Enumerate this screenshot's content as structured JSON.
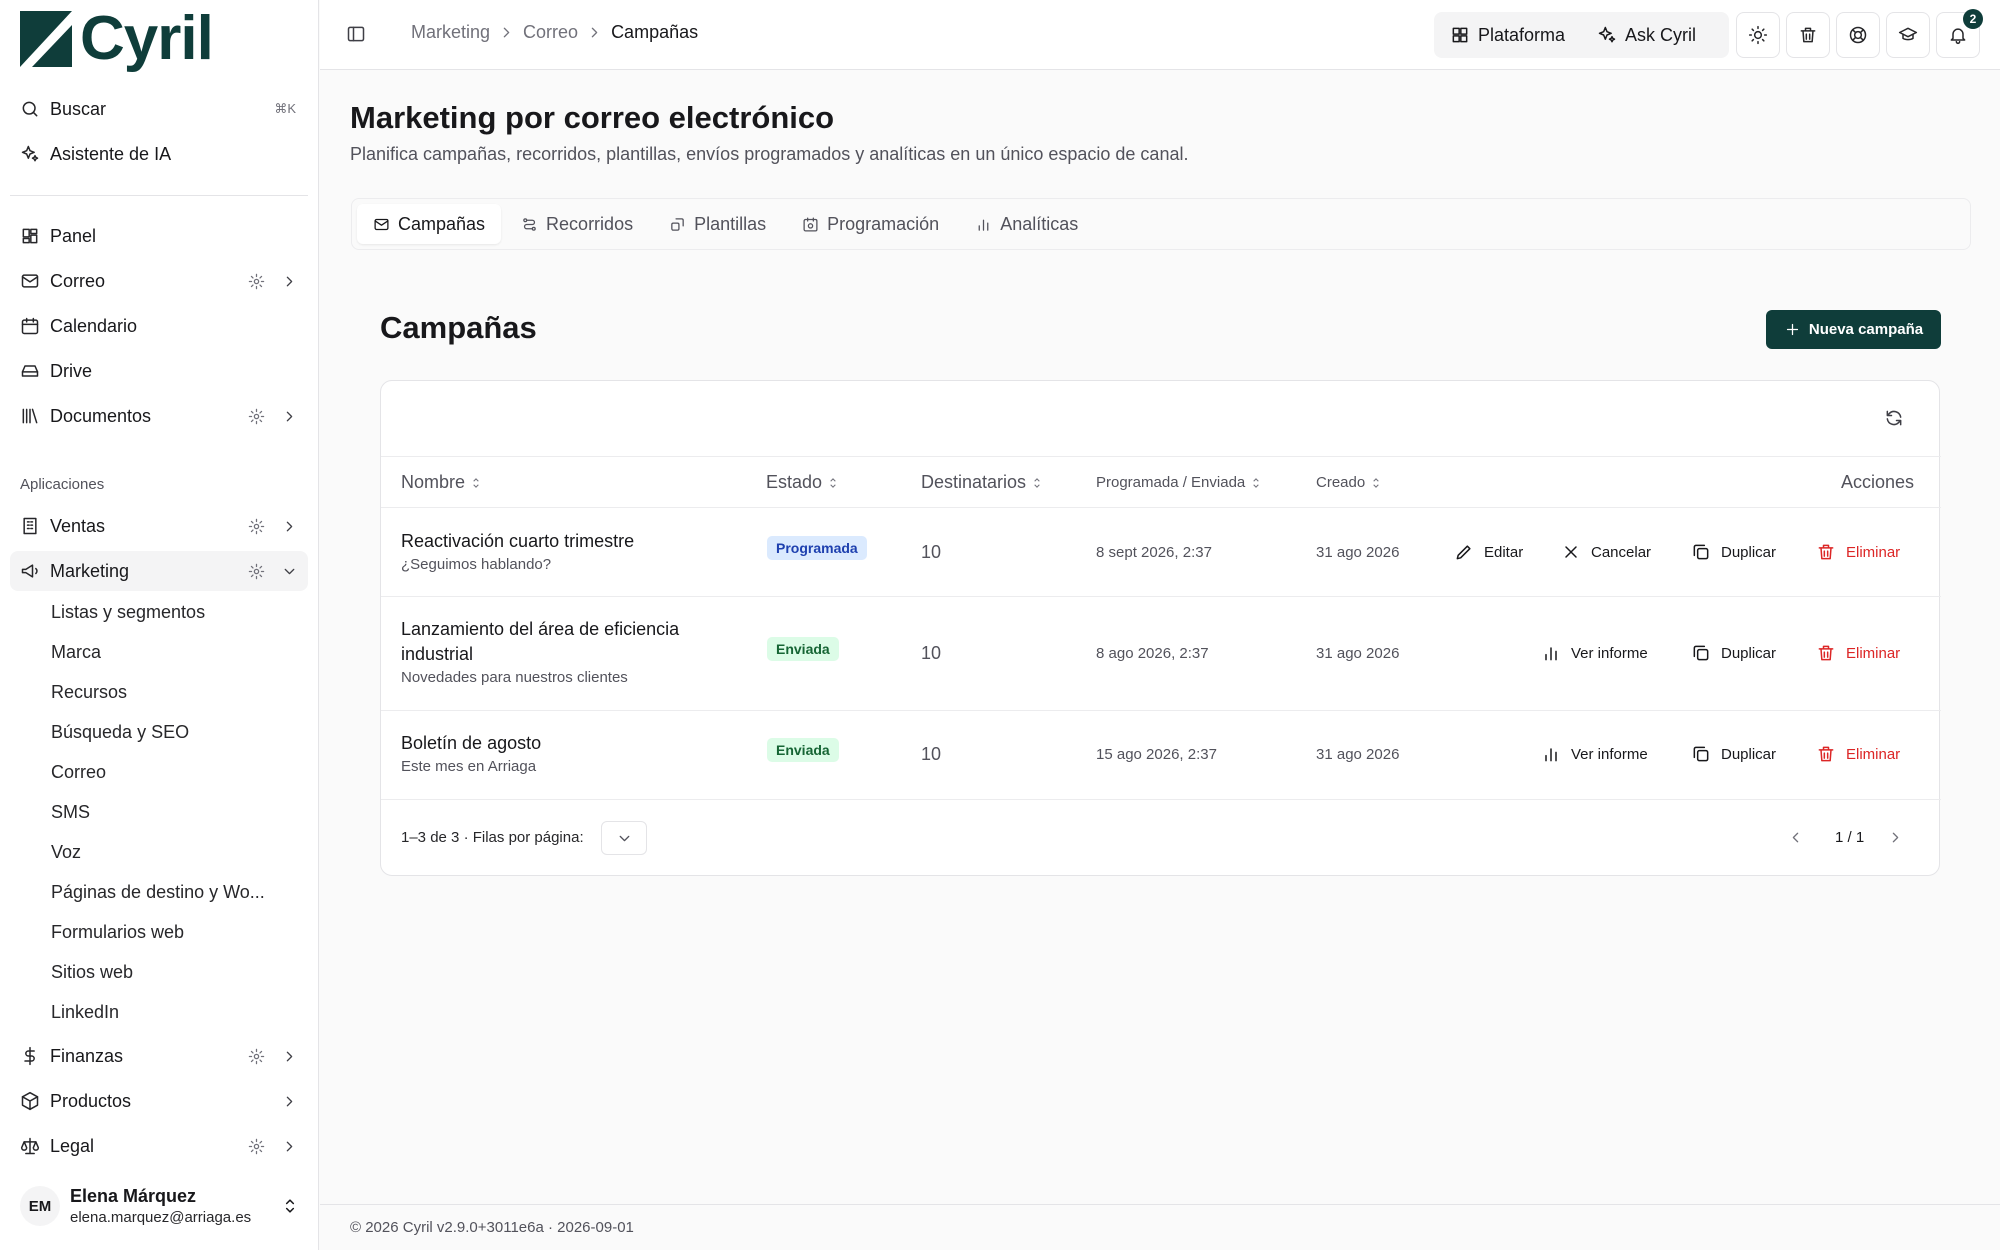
{
  "app": {
    "name": "Cyril",
    "brand_color": "#0f3d3a"
  },
  "sidebar": {
    "search_label": "Buscar",
    "search_shortcut": "⌘K",
    "assistant_label": "Asistente de IA",
    "items": [
      {
        "label": "Panel",
        "icon": "dashboard-icon"
      },
      {
        "label": "Correo",
        "icon": "mail-icon"
      },
      {
        "label": "Calendario",
        "icon": "calendar-icon"
      },
      {
        "label": "Drive",
        "icon": "drive-icon"
      },
      {
        "label": "Documentos",
        "icon": "library-icon"
      }
    ],
    "apps_heading": "Aplicaciones",
    "apps": [
      {
        "label": "Ventas",
        "icon": "building-icon"
      },
      {
        "label": "Marketing",
        "icon": "megaphone-icon"
      },
      {
        "label": "Finanzas",
        "icon": "dollar-icon"
      },
      {
        "label": "Productos",
        "icon": "box-icon"
      },
      {
        "label": "Legal",
        "icon": "scale-icon"
      }
    ],
    "marketing_sub": [
      "Listas y segmentos",
      "Marca",
      "Recursos",
      "Búsqueda y SEO",
      "Correo",
      "SMS",
      "Voz",
      "Páginas de destino y Wo...",
      "Formularios web",
      "Sitios web",
      "LinkedIn"
    ],
    "user": {
      "initials": "EM",
      "name": "Elena Márquez",
      "email": "elena.marquez@arriaga.es"
    }
  },
  "topbar": {
    "breadcrumb": [
      "Marketing",
      "Correo",
      "Campañas"
    ],
    "platform_label": "Plataforma",
    "ask_label": "Ask Cyril",
    "notifications_count": "2"
  },
  "page": {
    "title": "Marketing por correo electrónico",
    "subtitle": "Planifica campañas, recorridos, plantillas, envíos programados y analíticas en un único espacio de canal.",
    "tabs": [
      "Campañas",
      "Recorridos",
      "Plantillas",
      "Programación",
      "Analíticas"
    ],
    "section_title": "Campañas",
    "new_button": "Nueva campaña"
  },
  "table": {
    "headers": {
      "name": "Nombre",
      "status": "Estado",
      "recipients": "Destinatarios",
      "scheduled": "Programada / Enviada",
      "created": "Creado",
      "actions": "Acciones"
    },
    "rows": [
      {
        "name": "Reactivación cuarto trimestre",
        "subject": "¿Seguimos hablando?",
        "status": "Programada",
        "recipients": "10",
        "scheduled": "8 sept 2026, 2:37",
        "created": "31 ago 2026",
        "actions": [
          "Editar",
          "Cancelar",
          "Duplicar",
          "Eliminar"
        ]
      },
      {
        "name": "Lanzamiento del área de eficiencia industrial",
        "subject": "Novedades para nuestros clientes",
        "status": "Enviada",
        "recipients": "10",
        "scheduled": "8 ago 2026, 2:37",
        "created": "31 ago 2026",
        "actions": [
          "Ver informe",
          "Duplicar",
          "Eliminar"
        ]
      },
      {
        "name": "Boletín de agosto",
        "subject": "Este mes en Arriaga",
        "status": "Enviada",
        "recipients": "10",
        "scheduled": "15 ago 2026, 2:37",
        "created": "31 ago 2026",
        "actions": [
          "Ver informe",
          "Duplicar",
          "Eliminar"
        ]
      }
    ],
    "range_label": "1–3 de 3",
    "rows_per_page_label": "· Filas por página:",
    "page_label": "1 / 1"
  },
  "footer": {
    "text": "© 2026 Cyril v2.9.0+3011e6a · 2026-09-01"
  }
}
